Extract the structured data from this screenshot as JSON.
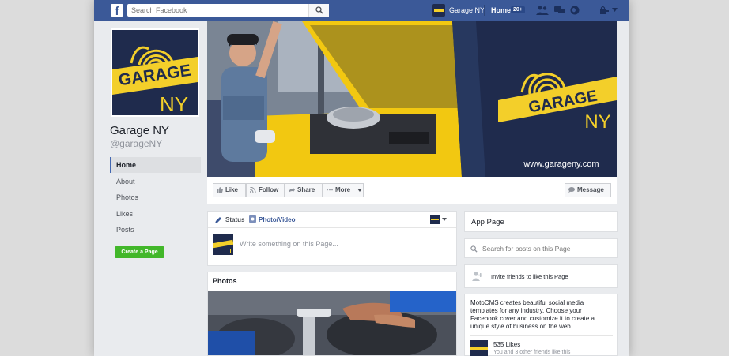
{
  "topbar": {
    "search_placeholder": "Search Facebook",
    "profile_name": "Garage NY",
    "home_label": "Home",
    "home_count": "20+"
  },
  "logo": {
    "line1": "GARAGE",
    "line2": "NY"
  },
  "profile": {
    "name": "Garage NY",
    "handle": "@garageNY"
  },
  "sidebar": {
    "items": [
      {
        "label": "Home",
        "active": true
      },
      {
        "label": "About"
      },
      {
        "label": "Photos"
      },
      {
        "label": "Likes"
      },
      {
        "label": "Posts"
      }
    ],
    "create_page": "Create a Page"
  },
  "cover": {
    "brand_line1": "GARAGE",
    "brand_line2": "NY",
    "url": "www.garageny.com"
  },
  "actions": {
    "like": "Like",
    "follow": "Follow",
    "share": "Share",
    "more": "More",
    "message": "Message"
  },
  "composer": {
    "status_tab": "Status",
    "photo_tab": "Photo/Video",
    "placeholder": "Write something on this Page..."
  },
  "photos": {
    "title": "Photos"
  },
  "right": {
    "app_page": "App Page",
    "search_placeholder": "Search for posts on this Page",
    "invite": "Invite friends to like this Page",
    "about": "MotoCMS creates beautiful social media templates for any industry. Choose your Facebook cover and customize it to create a unique style of business on the web.",
    "likes": "535 Likes",
    "likes_sub": "You and 3 other friends like this"
  },
  "colors": {
    "facebook_blue": "#3b5998",
    "brand_navy": "#1f2b4d",
    "brand_yellow": "#f3cf2a",
    "create_green": "#42b72a"
  }
}
